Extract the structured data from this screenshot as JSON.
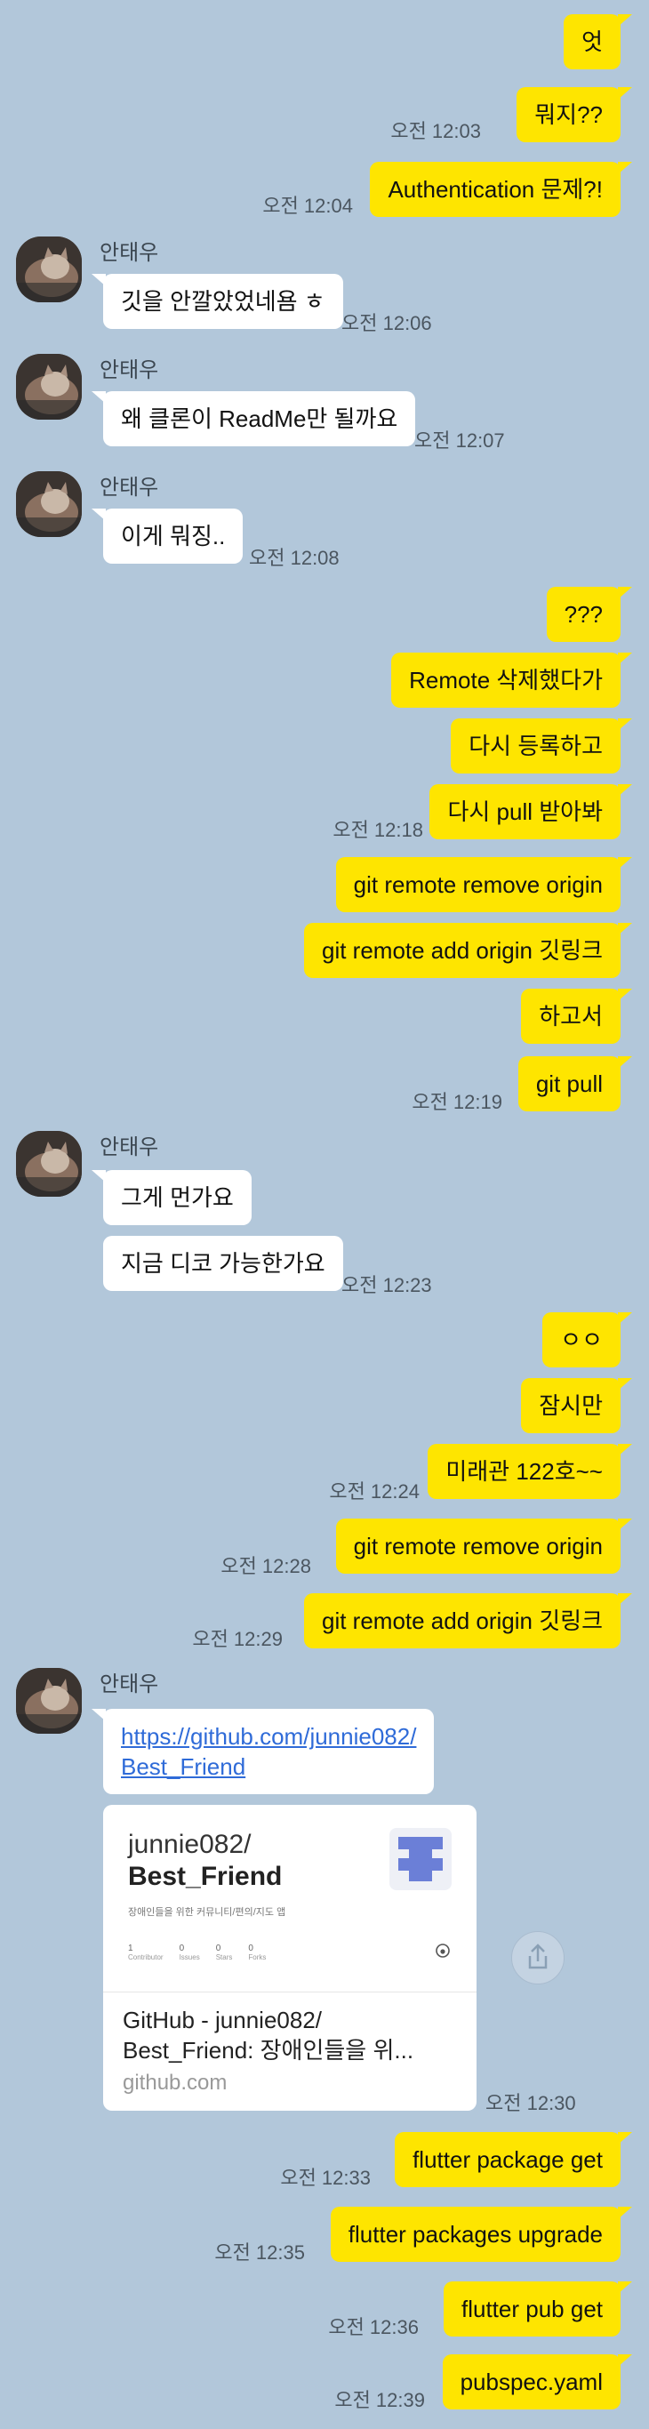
{
  "contact": {
    "name": "안태우",
    "avatar_icon": "cat-avatar-icon"
  },
  "colors": {
    "background": "#b2c7da",
    "my_bubble": "#fee500",
    "their_bubble": "#ffffff"
  },
  "messages": [
    {
      "text": "엇"
    },
    {
      "text": "뭐지??",
      "time": "오전 12:03"
    },
    {
      "text": "Authentication 문제?!",
      "time": "오전 12:04"
    },
    {
      "text": "깃을 안깔았었네욤 ㅎ",
      "time": "오전 12:06"
    },
    {
      "text": "왜 클론이 ReadMe만 될까요",
      "time": "오전 12:07"
    },
    {
      "text": "이게 뭐징..",
      "time": "오전 12:08"
    },
    {
      "text": "???"
    },
    {
      "text": "Remote 삭제했다가"
    },
    {
      "text": "다시 등록하고"
    },
    {
      "text": "다시 pull 받아봐",
      "time": "오전 12:18"
    },
    {
      "text": "git remote remove origin"
    },
    {
      "text": "git remote add origin 깃링크"
    },
    {
      "text": "하고서"
    },
    {
      "text": "git pull",
      "time": "오전 12:19"
    },
    {
      "text": "그게 먼가요"
    },
    {
      "text": "지금 디코 가능한가요",
      "time": "오전 12:23"
    },
    {
      "text": "ㅇㅇ"
    },
    {
      "text": "잠시만"
    },
    {
      "text": "미래관 122호~~",
      "time": "오전 12:24"
    },
    {
      "text": "git remote remove origin",
      "time": "오전 12:28"
    },
    {
      "text": "git remote add origin 깃링크",
      "time": "오전 12:29"
    },
    {
      "text": "https://github.com/junnie082/",
      "text2": "Best_Friend"
    },
    {
      "text": "flutter package get",
      "time": "오전 12:33"
    },
    {
      "text": "flutter packages upgrade",
      "time": "오전 12:35"
    },
    {
      "text": "flutter pub get",
      "time": "오전 12:36"
    },
    {
      "text": "pubspec.yaml",
      "time": "오전 12:39"
    }
  ],
  "link_card": {
    "owner": "junnie082/",
    "repo": "Best_Friend",
    "description": "장애인들을 위한 커뮤니티/편의/지도 앱",
    "stats": [
      {
        "value": "1",
        "label": "Contributor"
      },
      {
        "value": "0",
        "label": "Issues"
      },
      {
        "value": "0",
        "label": "Stars"
      },
      {
        "value": "0",
        "label": "Forks"
      }
    ],
    "title": "GitHub - junnie082/ Best_Friend: 장애인들을 위...",
    "domain": "github.com",
    "time": "오전 12:30"
  }
}
